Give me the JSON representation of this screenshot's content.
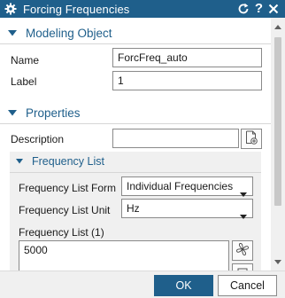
{
  "window": {
    "title": "Forcing Frequencies",
    "icons": {
      "app": "gear-icon",
      "reset": "reset-icon",
      "help": "help-icon",
      "close": "close-icon"
    },
    "help_glyph": "?",
    "accent_color": "#1f5f8b"
  },
  "modeling_object": {
    "header": "Modeling Object",
    "name_label": "Name",
    "name_value": "ForcFreq_auto",
    "label_label": "Label",
    "label_value": "1"
  },
  "properties": {
    "header": "Properties",
    "description_label": "Description",
    "description_value": "",
    "description_button_icon": "add-document-icon"
  },
  "frequency_list": {
    "header": "Frequency List",
    "form_label": "Frequency List Form",
    "form_value": "Individual Frequencies",
    "unit_label": "Frequency List Unit",
    "unit_value": "Hz",
    "list_label": "Frequency List (1)",
    "list_values": [
      "5000"
    ],
    "list_button_icon": "propeller-icon"
  },
  "footer": {
    "ok_label": "OK",
    "cancel_label": "Cancel"
  }
}
